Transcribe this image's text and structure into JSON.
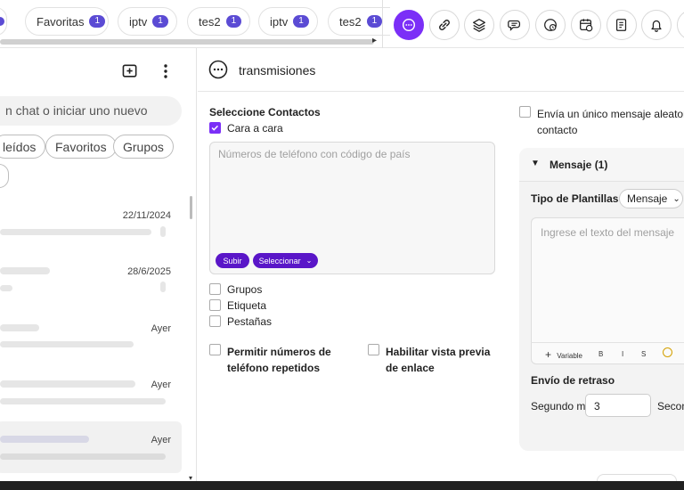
{
  "tabs": [
    {
      "label": "Favoritas",
      "count": "1"
    },
    {
      "label": "iptv",
      "count": "1"
    },
    {
      "label": "tes2",
      "count": "1"
    },
    {
      "label": "iptv",
      "count": "1"
    },
    {
      "label": "tes2",
      "count": "1"
    }
  ],
  "toolbar_icons": [
    "broadcast-icon",
    "link-icon",
    "layers-icon",
    "chat-bubbles-icon",
    "chat-clock-icon",
    "calendar-clock-icon",
    "notes-icon",
    "bell-icon"
  ],
  "sidebar": {
    "search_placeholder": "n chat o iniciar uno nuevo",
    "filters": [
      "leídos",
      "Favoritos",
      "Grupos"
    ],
    "chats": [
      {
        "date": "22/11/2024"
      },
      {
        "date": "28/6/2025"
      },
      {
        "date": "Ayer"
      },
      {
        "date": "Ayer"
      },
      {
        "date": "Ayer"
      }
    ]
  },
  "main": {
    "title": "transmisiones",
    "select_contacts_label": "Seleccione Contactos",
    "face_to_face_label": "Cara a cara",
    "phone_placeholder": "Números de teléfono con código de país",
    "upload_label": "Subir",
    "select_label": "Seleccionar",
    "options": [
      "Grupos",
      "Etiqueta",
      "Pestañas"
    ],
    "allow_duplicates_label": "Permitir números de teléfono repetidos",
    "link_preview_label": "Habilitar vista previa de enlace",
    "random_message_label": "Envía un único mensaje aleatorio contacto"
  },
  "message_panel": {
    "title": "Mensaje (1)",
    "template_type_label": "Tipo de Plantillas",
    "template_type_value": "Mensaje",
    "message_placeholder": "Ingrese el texto del mensaje",
    "variable_label": "Variable",
    "format_buttons": [
      "B",
      "I",
      "S"
    ],
    "delay_label": "Envío de retraso",
    "seconds_min_label": "Segundo mi",
    "seconds_min_value": "3",
    "seconds_max_label": "Secon"
  },
  "colors": {
    "accent": "#7b2ff7",
    "badge": "#5b4bd4",
    "button": "#5a16c8"
  }
}
